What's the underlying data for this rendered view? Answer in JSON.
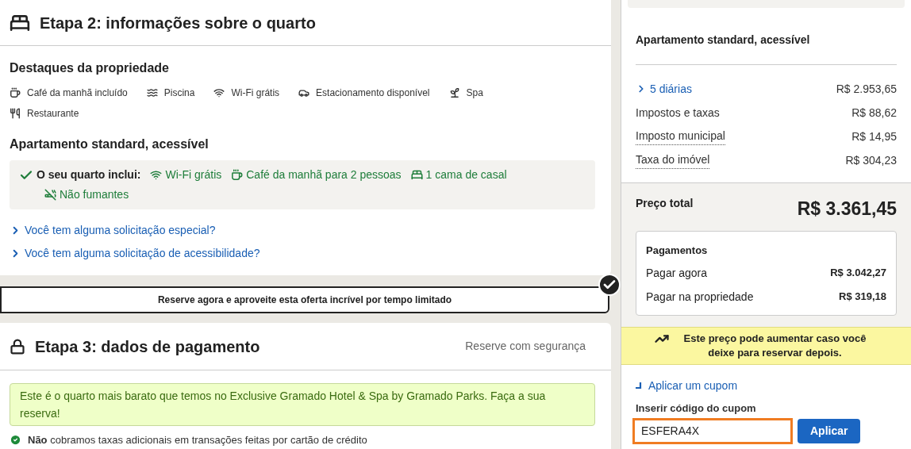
{
  "step2": {
    "title": "Etapa 2: informações sobre o quarto",
    "highlights_heading": "Destaques da propriedade",
    "highlights": [
      {
        "kind": "breakfast",
        "label": "Café da manhã incluído"
      },
      {
        "kind": "pool",
        "label": "Piscina"
      },
      {
        "kind": "wifi",
        "label": "Wi-Fi grátis"
      },
      {
        "kind": "parking",
        "label": "Estacionamento disponível"
      },
      {
        "kind": "spa",
        "label": "Spa"
      },
      {
        "kind": "restaurant",
        "label": "Restaurante"
      }
    ],
    "room_title": "Apartamento standard, acessível",
    "includes_label": "O seu quarto inclui:",
    "includes": [
      {
        "kind": "wifi",
        "label": "Wi-Fi grátis"
      },
      {
        "kind": "breakfast",
        "label": "Café da manhã para 2 pessoas"
      },
      {
        "kind": "bed",
        "label": "1 cama de casal"
      },
      {
        "kind": "nosmoking",
        "label": "Não fumantes"
      }
    ],
    "links": [
      "Você tem alguma solicitação especial?",
      "Você tem alguma solicitação de acessibilidade?"
    ]
  },
  "banner": {
    "text": "Reserve agora e aproveite esta oferta incrível por tempo limitado",
    "checked": true
  },
  "step3": {
    "title": "Etapa 3: dados de pagamento",
    "secure_label": "Reserve com segurança",
    "alert": "Este é o quarto mais barato que temos no Exclusive Gramado Hotel & Spa by Gramado Parks. Faça a sua reserva!",
    "notes": [
      "**Não** cobramos taxas adicionais em transações feitas por cartão de crédito"
    ]
  },
  "summary": {
    "room_title": "Apartamento standard, acessível",
    "lines": [
      {
        "kind": "link",
        "label": "5 diárias",
        "value": "R$ 2.953,65"
      },
      {
        "kind": "plain",
        "label": "Impostos e taxas",
        "value": "R$ 88,62"
      },
      {
        "kind": "dotted",
        "label": "Imposto municipal",
        "value": "R$ 14,95"
      },
      {
        "kind": "dotted",
        "label": "Taxa do imóvel",
        "value": "R$ 304,23"
      }
    ],
    "total_label": "Preço total",
    "total_value": "R$ 3.361,45",
    "payments": {
      "title": "Pagamentos",
      "rows": [
        {
          "label": "Pagar agora",
          "value": "R$ 3.042,27"
        },
        {
          "label": "Pagar na propriedade",
          "value": "R$ 319,18"
        }
      ]
    },
    "price_alert": "Este preço pode aumentar caso você deixe para reservar depois.",
    "coupon": {
      "toggle_label": "Aplicar um cupom",
      "field_label": "Inserir código do cupom",
      "value": "ESFERA4X",
      "button": "Aplicar"
    }
  }
}
